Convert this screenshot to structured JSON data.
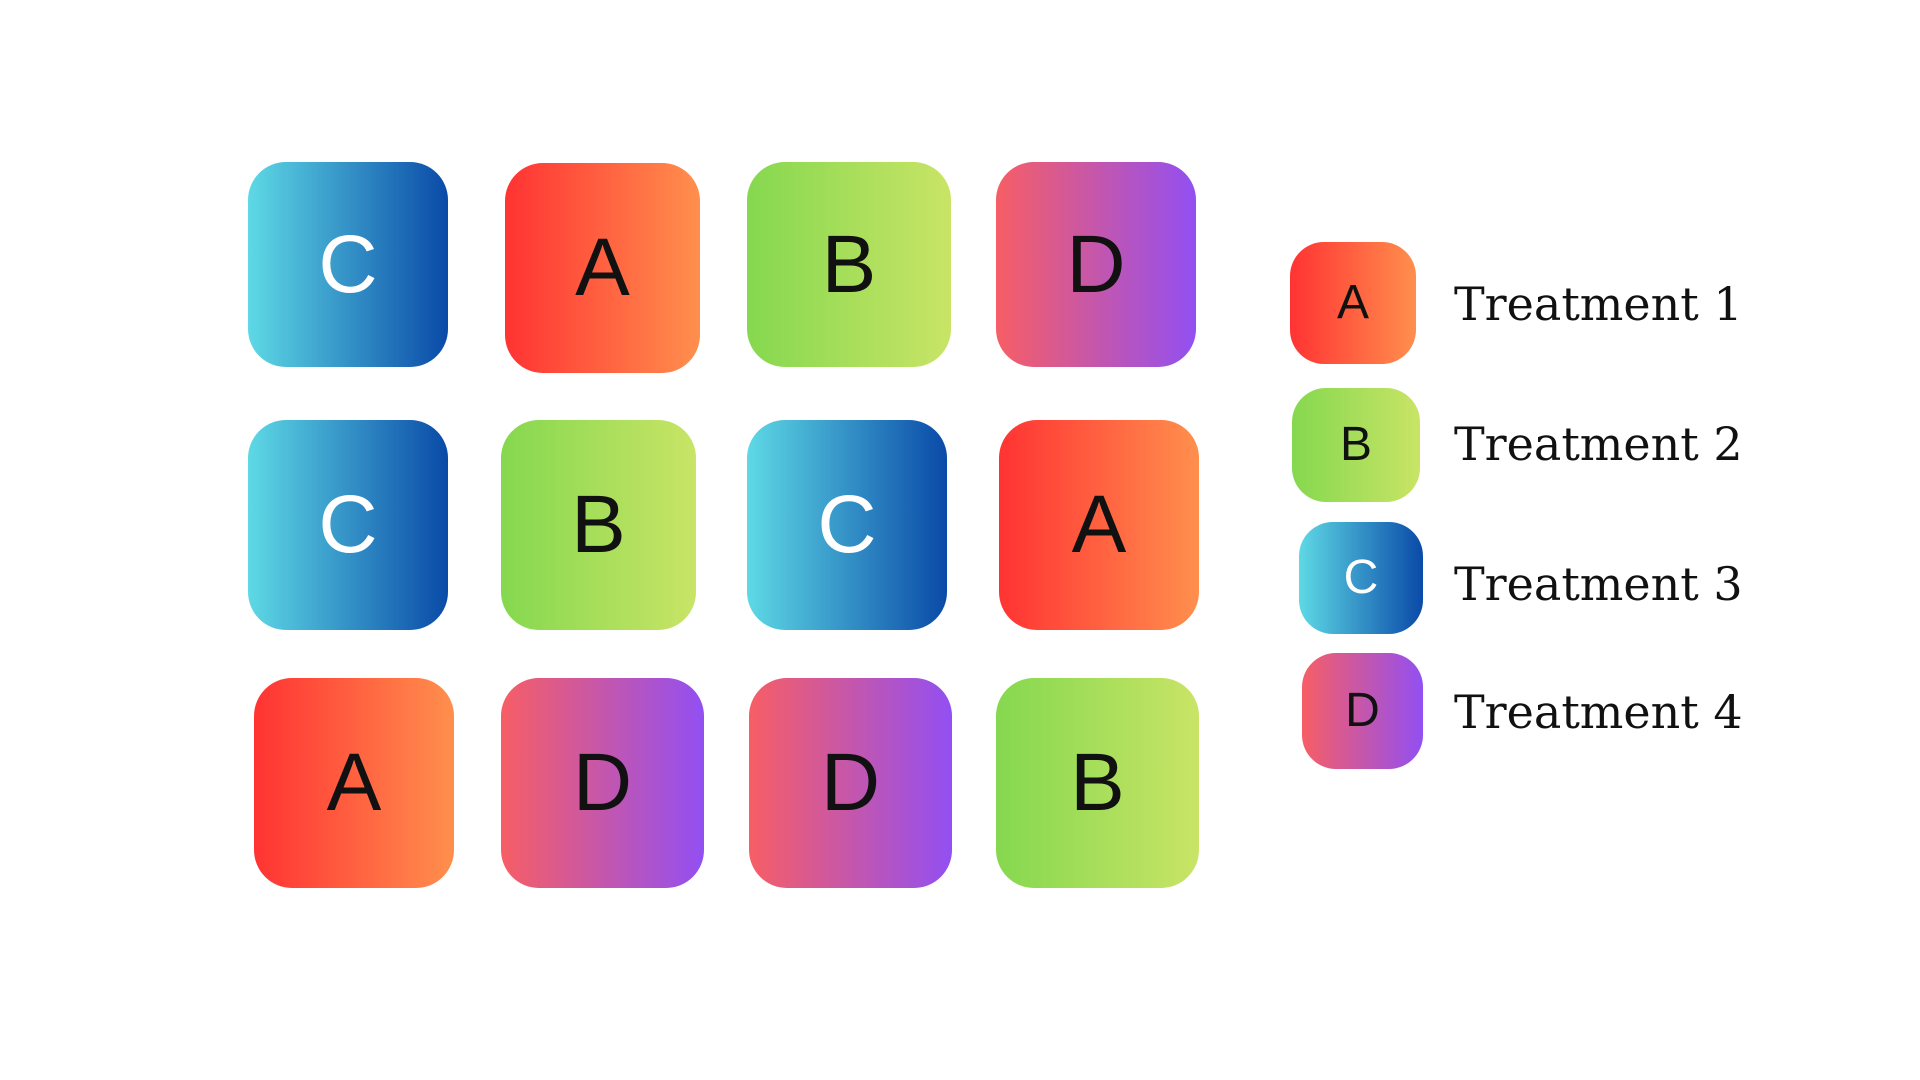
{
  "grid": {
    "rows": [
      [
        "C",
        "A",
        "B",
        "D"
      ],
      [
        "C",
        "B",
        "C",
        "A"
      ],
      [
        "A",
        "D",
        "D",
        "B"
      ]
    ]
  },
  "legend": {
    "items": [
      {
        "key": "A",
        "label": "Treatment 1"
      },
      {
        "key": "B",
        "label": "Treatment 2"
      },
      {
        "key": "C",
        "label": "Treatment 3"
      },
      {
        "key": "D",
        "label": "Treatment 4"
      }
    ]
  },
  "colors": {
    "A": {
      "from": "#ff3333",
      "to": "#ff8f4d",
      "text": "#111111"
    },
    "B": {
      "from": "#85d84f",
      "to": "#c9e466",
      "text": "#111111"
    },
    "C": {
      "from": "#5ed9e5",
      "to": "#0a4aa8",
      "text": "#ffffff"
    },
    "D": {
      "from": "#f75e65",
      "to": "#924ff2",
      "text": "#111111"
    }
  }
}
